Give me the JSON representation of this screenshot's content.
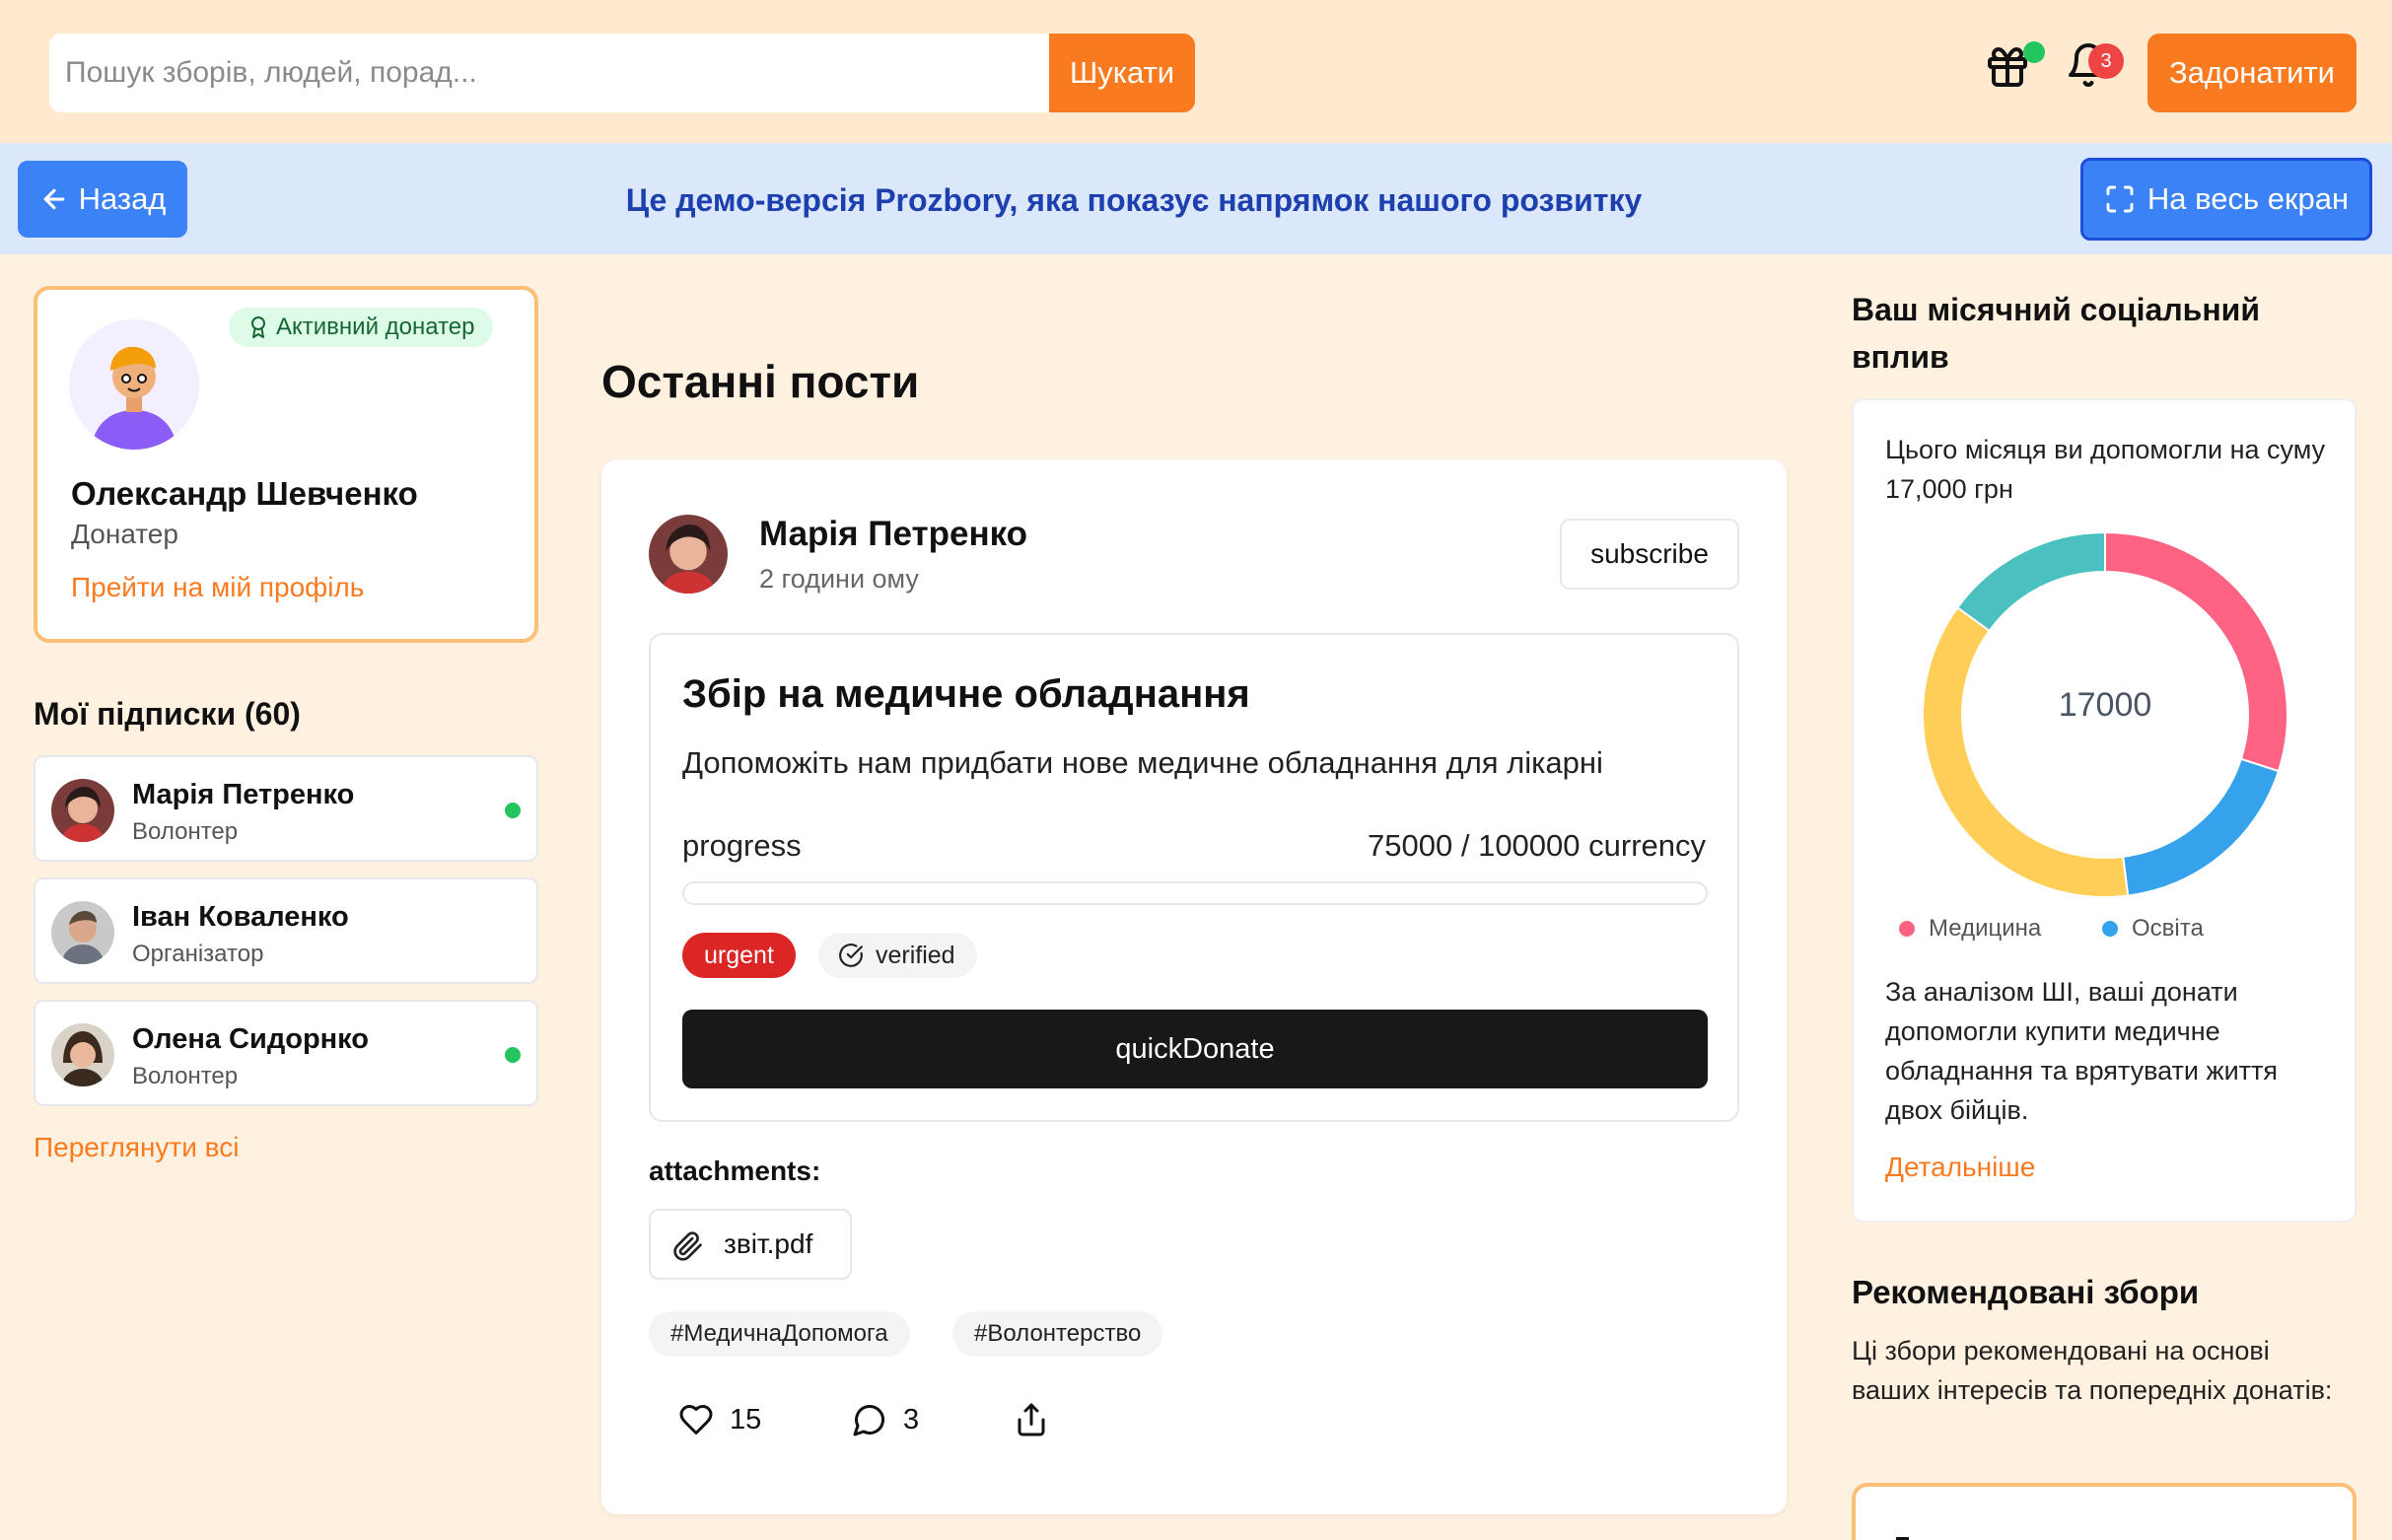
{
  "search": {
    "placeholder": "Пошук зборів, людей, порад...",
    "button": "Шукати"
  },
  "header": {
    "notifications_count": "3",
    "donate_button": "Задонатити",
    "icons": [
      "gift-icon",
      "bell-icon"
    ],
    "accent": "#f97a1f"
  },
  "banner": {
    "back": "Назад",
    "text": "Це демо-версія Prozbory, яка показує напрямок нашого розвитку",
    "fullscreen": "На весь екран"
  },
  "profile": {
    "badge": "Активний донатер",
    "name": "Олександр Шевченко",
    "role": "Донатер",
    "link": "Прейти на мій профіль"
  },
  "subscriptions": {
    "title": "Мої підписки (60)",
    "items": [
      {
        "name": "Марія Петренко",
        "role": "Волонтер",
        "online": true
      },
      {
        "name": "Іван Коваленко",
        "role": "Організатор",
        "online": false
      },
      {
        "name": "Олена Сидорнко",
        "role": "Волонтер",
        "online": true
      }
    ],
    "view_all": "Переглянути всі"
  },
  "feed": {
    "title": "Останні пости",
    "post": {
      "author": "Марія Петренко",
      "time": "2 години ому",
      "subscribe": "subscribe",
      "fund": {
        "title": "Збір на медичне обладнання",
        "description": "Допоможіть нам придбати нове медичне обладнання для лікарні",
        "progress_label": "progress",
        "progress_value": "75000 / 100000 currency",
        "progress": 0.75,
        "tags": [
          "urgent",
          "verified"
        ],
        "quick_donate": "quickDonate"
      },
      "attachments_label": "attachments:",
      "attachment": "звіт.pdf",
      "hashtags": [
        "#МедичнаДопомога",
        "#Волонтерство"
      ],
      "likes": "15",
      "comments": "3"
    }
  },
  "impact": {
    "title": "Ваш місячний соціальний вплив",
    "summary": "Цього місяця ви допомогли на суму 17,000 грн",
    "center": "17000",
    "legend": [
      {
        "label": "Медицина",
        "color": "#ff6384"
      },
      {
        "label": "Освіта",
        "color": "#36a2eb"
      }
    ],
    "ai_text": "За аналізом ШІ, ваші донати допомогли купити медичне обладнання та врятувати життя двох бійців.",
    "more": "Детальніше"
  },
  "chart_data": {
    "type": "pie",
    "categories": [
      "Медицина",
      "Освіта",
      "",
      ""
    ],
    "values": [
      0.3,
      0.18,
      0.37,
      0.15
    ],
    "colors": [
      "#ff6384",
      "#36a2eb",
      "#ffce56",
      "#4bc0c0"
    ]
  },
  "recommended": {
    "title": "Рекомендовані збори",
    "description": "Ці збори рекомендовані на основі ваших інтересів та попередніх донатів:",
    "card_title": "Допомога переселенцям"
  }
}
